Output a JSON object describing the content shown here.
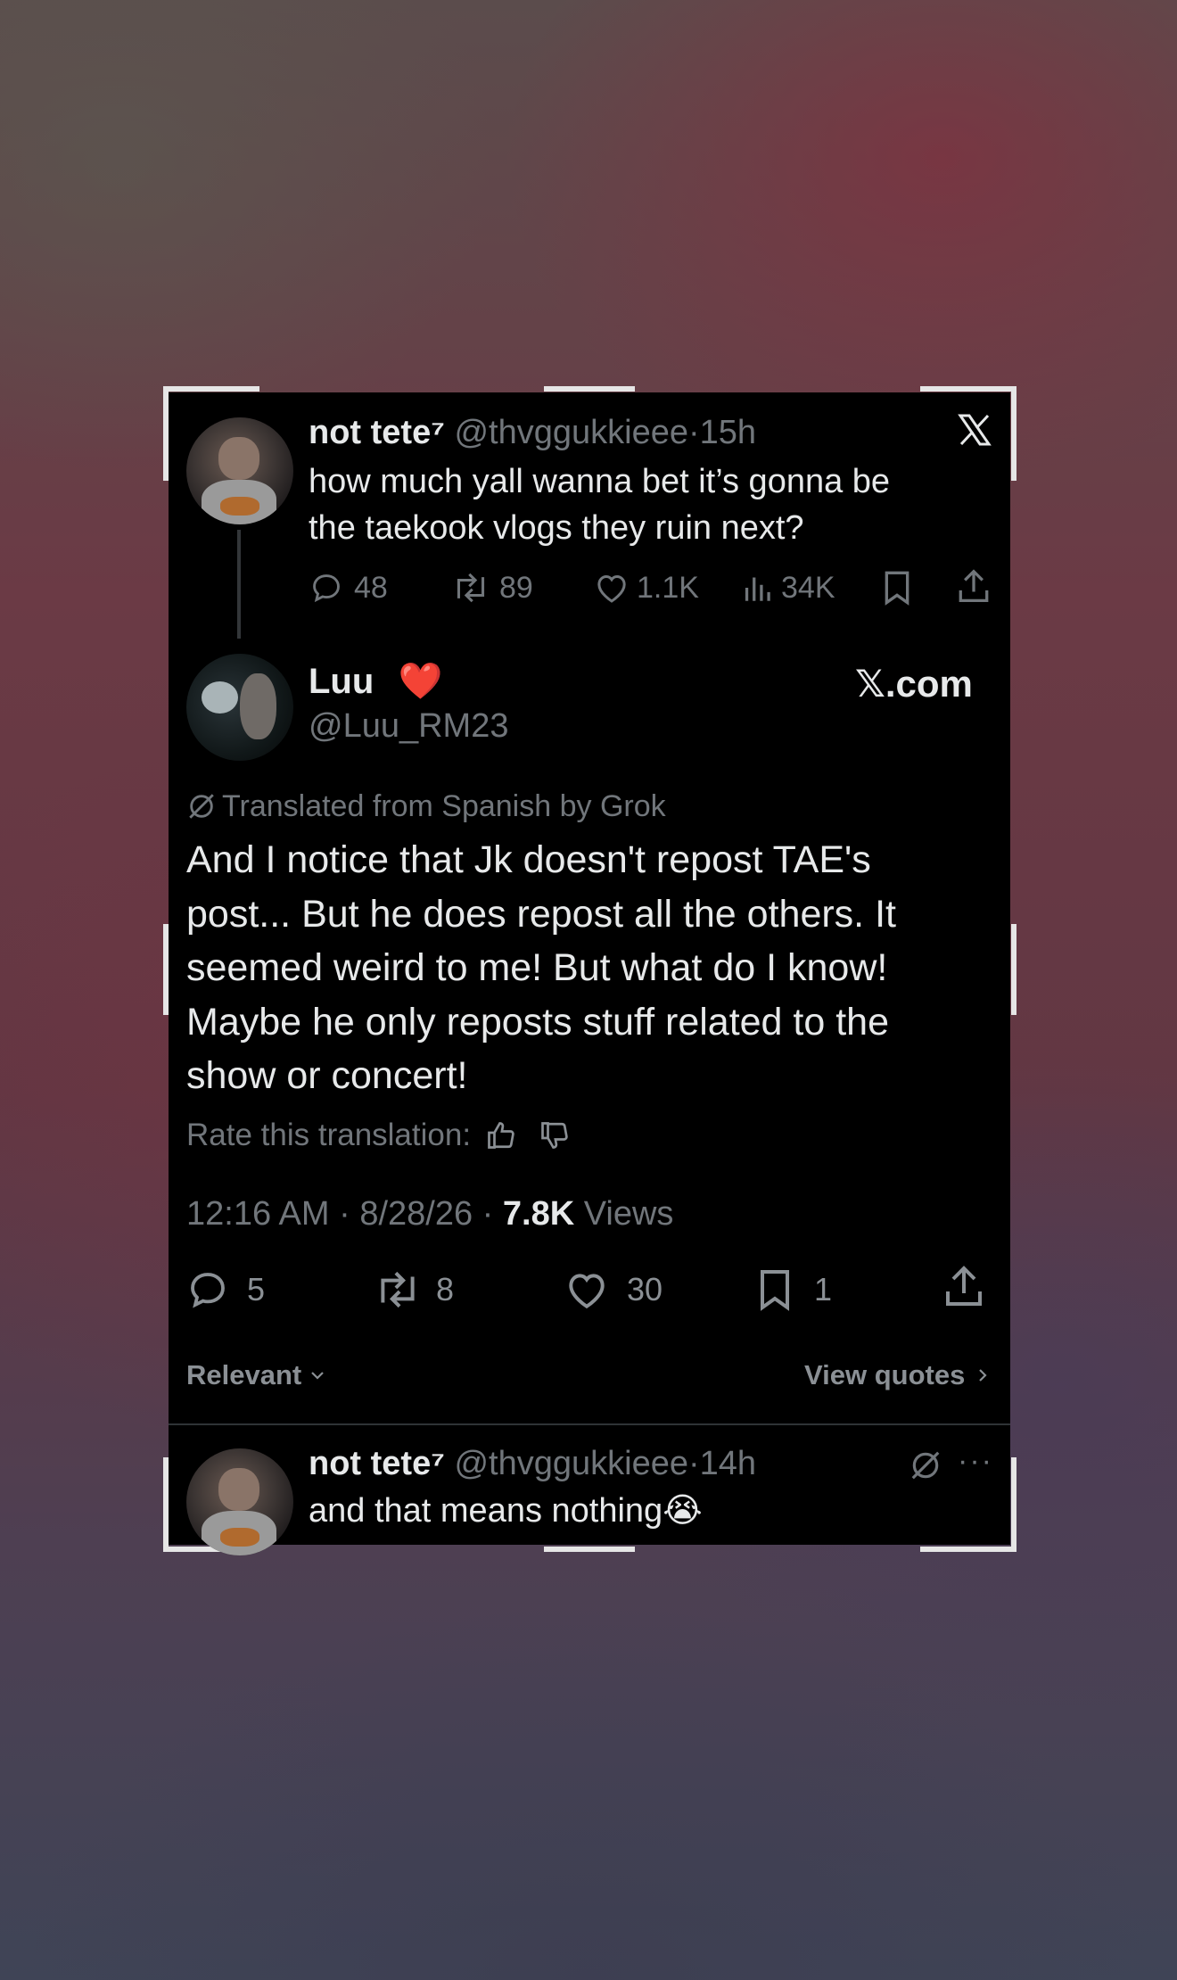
{
  "card": {
    "logo": "x-logo-icon",
    "watermark": "𝕏.com",
    "post1": {
      "display_name": "not tete⁷",
      "handle": "@thvggukkieee",
      "separator": "·",
      "time": "15h",
      "text_line1": "how much yall wanna bet it’s gonna be",
      "text_line2": "the taekook vlogs they ruin next?",
      "replies": "48",
      "reposts": "89",
      "likes": "1.1K",
      "views": "34K"
    },
    "main": {
      "display_name": "Luu",
      "name_emoji": "❤️",
      "handle": "@Luu_RM23",
      "translated_label": "Translated from Spanish by Grok",
      "body_lines": [
        "And I notice that Jk doesn't repost TAE's",
        "post... But he does repost all the others. It",
        "seemed weird to me! But what do I know!",
        "Maybe he only reposts stuff related to the",
        "show or concert!"
      ],
      "rate_label": "Rate this translation:",
      "timestamp": "12:16 AM · 8/28/26 ·",
      "views_count": "7.8K",
      "views_label": "Views",
      "replies": "5",
      "reposts": "8",
      "likes": "30",
      "bookmarks": "1"
    },
    "sort_label": "Relevant",
    "view_quotes": "View quotes",
    "reply": {
      "display_name": "not tete⁷",
      "handle": "@thvggukkieee",
      "separator": "·",
      "time": "14h",
      "text": "and that means nothing",
      "emoji": "😭"
    }
  },
  "colors": {
    "card_bg": "#000000",
    "text": "#e7e9ea",
    "muted": "#71767b",
    "heart": "#f4212e"
  }
}
